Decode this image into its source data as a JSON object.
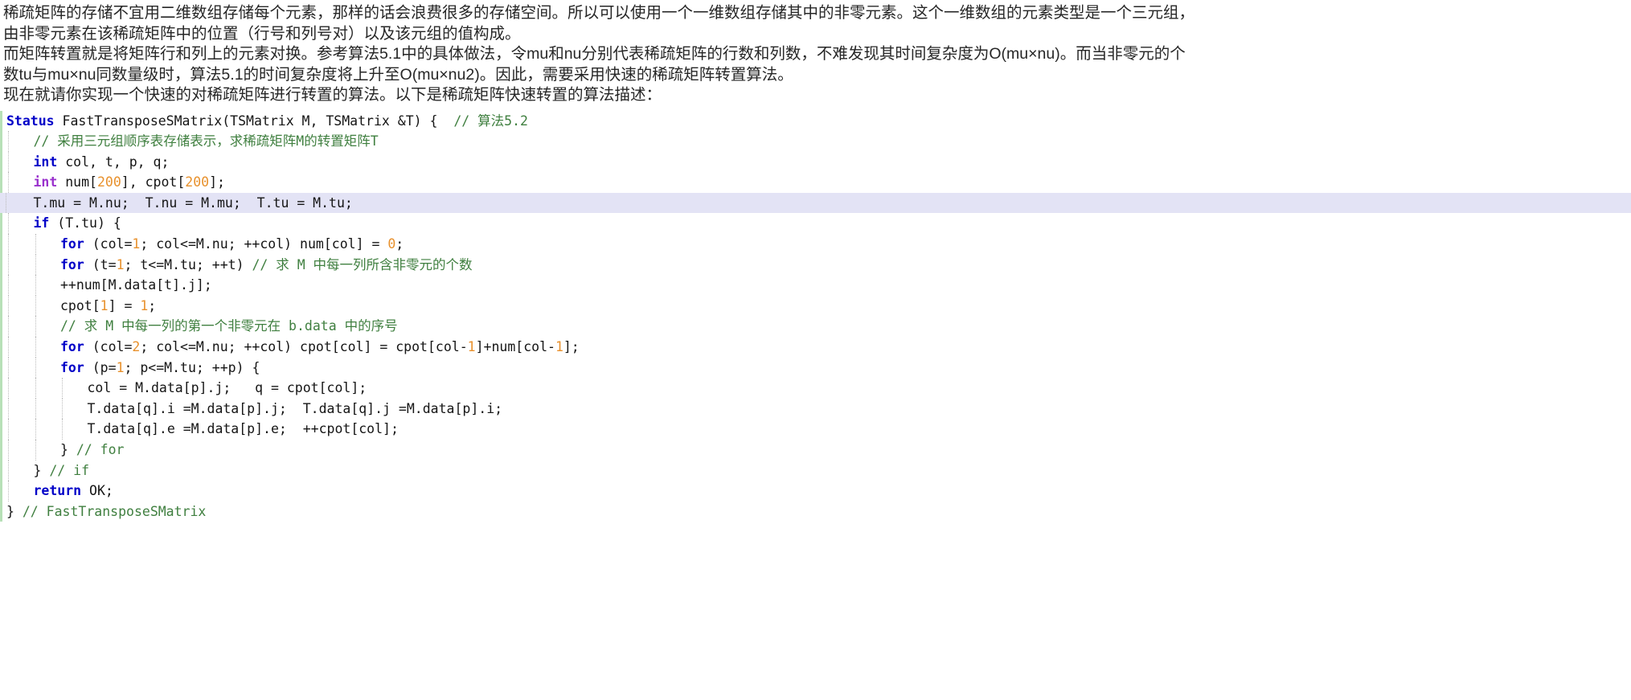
{
  "document": {
    "language": "zh-CN",
    "prose": [
      "稀疏矩阵的存储不宜用二维数组存储每个元素，那样的话会浪费很多的存储空间。所以可以使用一个一维数组存储其中的非零元素。这个一维数组的元素类型是一个三元组，",
      "由非零元素在该稀疏矩阵中的位置（行号和列号对）以及该元组的值构成。",
      "而矩阵转置就是将矩阵行和列上的元素对换。参考算法5.1中的具体做法，令mu和nu分别代表稀疏矩阵的行数和列数，不难发现其时间复杂度为O(mu×nu)。而当非零元的个",
      "数tu与mu×nu同数量级时，算法5.1的时间复杂度将上升至O(mu×nu2)。因此，需要采用快速的稀疏矩阵转置算法。",
      "现在就请你实现一个快速的对稀疏矩阵进行转置的算法。以下是稀疏矩阵快速转置的算法描述："
    ]
  },
  "code": {
    "language": "c",
    "highlighted_line_index": 4,
    "colors": {
      "keyword": "#0000c8",
      "type_keyword": "#9a32cd",
      "comment": "#3f7f3f",
      "number": "#e8912d",
      "plain": "#151515",
      "highlight_background": "#e3e3f5",
      "left_border": "#b7e0b7",
      "indent_guide": "#bcbcbc"
    },
    "lines": [
      {
        "indent": 0,
        "tokens": [
          {
            "t": "kw",
            "v": "Status"
          },
          {
            "t": "pln",
            "v": " FastTransposeSMatrix(TSMatrix M, TSMatrix &T) {  "
          },
          {
            "t": "cmt",
            "v": "// 算法5.2"
          }
        ]
      },
      {
        "indent": 1,
        "tokens": [
          {
            "t": "cmt",
            "v": "// 采用三元组顺序表存储表示，求稀疏矩阵M的转置矩阵T"
          }
        ]
      },
      {
        "indent": 1,
        "tokens": [
          {
            "t": "kw",
            "v": "int"
          },
          {
            "t": "pln",
            "v": " col, t, p, q;"
          }
        ]
      },
      {
        "indent": 1,
        "tokens": [
          {
            "t": "kw2",
            "v": "int"
          },
          {
            "t": "pln",
            "v": " num["
          },
          {
            "t": "num",
            "v": "200"
          },
          {
            "t": "pln",
            "v": "], cpot["
          },
          {
            "t": "num",
            "v": "200"
          },
          {
            "t": "pln",
            "v": "];"
          }
        ]
      },
      {
        "indent": 1,
        "tokens": [
          {
            "t": "pln",
            "v": "T.mu = M.nu;  T.nu = M.mu;  T.tu = M.tu;"
          }
        ]
      },
      {
        "indent": 1,
        "tokens": [
          {
            "t": "kw",
            "v": "if"
          },
          {
            "t": "pln",
            "v": " (T.tu) {"
          }
        ]
      },
      {
        "indent": 2,
        "tokens": [
          {
            "t": "kw",
            "v": "for"
          },
          {
            "t": "pln",
            "v": " (col="
          },
          {
            "t": "num",
            "v": "1"
          },
          {
            "t": "pln",
            "v": "; col<=M.nu; ++col) num[col] = "
          },
          {
            "t": "num",
            "v": "0"
          },
          {
            "t": "pln",
            "v": ";"
          }
        ]
      },
      {
        "indent": 2,
        "tokens": [
          {
            "t": "kw",
            "v": "for"
          },
          {
            "t": "pln",
            "v": " (t="
          },
          {
            "t": "num",
            "v": "1"
          },
          {
            "t": "pln",
            "v": "; t<=M.tu; ++t) "
          },
          {
            "t": "cmt",
            "v": "// 求 M 中每一列所含非零元的个数"
          }
        ]
      },
      {
        "indent": 2,
        "tokens": [
          {
            "t": "pln",
            "v": "++num[M.data[t].j];"
          }
        ]
      },
      {
        "indent": 2,
        "tokens": [
          {
            "t": "pln",
            "v": "cpot["
          },
          {
            "t": "num",
            "v": "1"
          },
          {
            "t": "pln",
            "v": "] = "
          },
          {
            "t": "num",
            "v": "1"
          },
          {
            "t": "pln",
            "v": ";"
          }
        ]
      },
      {
        "indent": 2,
        "tokens": [
          {
            "t": "cmt",
            "v": "// 求 M 中每一列的第一个非零元在 b.data 中的序号"
          }
        ]
      },
      {
        "indent": 2,
        "tokens": [
          {
            "t": "kw",
            "v": "for"
          },
          {
            "t": "pln",
            "v": " (col="
          },
          {
            "t": "num",
            "v": "2"
          },
          {
            "t": "pln",
            "v": "; col<=M.nu; ++col) cpot[col] = cpot[col-"
          },
          {
            "t": "num",
            "v": "1"
          },
          {
            "t": "pln",
            "v": "]+num[col-"
          },
          {
            "t": "num",
            "v": "1"
          },
          {
            "t": "pln",
            "v": "];"
          }
        ]
      },
      {
        "indent": 2,
        "tokens": [
          {
            "t": "kw",
            "v": "for"
          },
          {
            "t": "pln",
            "v": " (p="
          },
          {
            "t": "num",
            "v": "1"
          },
          {
            "t": "pln",
            "v": "; p<=M.tu; ++p) {"
          }
        ]
      },
      {
        "indent": 3,
        "tokens": [
          {
            "t": "pln",
            "v": "col = M.data[p].j;   q = cpot[col];"
          }
        ]
      },
      {
        "indent": 3,
        "tokens": [
          {
            "t": "pln",
            "v": "T.data[q].i =M.data[p].j;  T.data[q].j =M.data[p].i;"
          }
        ]
      },
      {
        "indent": 3,
        "tokens": [
          {
            "t": "pln",
            "v": "T.data[q].e =M.data[p].e;  ++cpot[col];"
          }
        ]
      },
      {
        "indent": 2,
        "tokens": [
          {
            "t": "pln",
            "v": "} "
          },
          {
            "t": "cmt",
            "v": "// for"
          }
        ]
      },
      {
        "indent": 1,
        "tokens": [
          {
            "t": "pln",
            "v": "} "
          },
          {
            "t": "cmt",
            "v": "// if"
          }
        ]
      },
      {
        "indent": 1,
        "tokens": [
          {
            "t": "kw",
            "v": "return"
          },
          {
            "t": "pln",
            "v": " OK;"
          }
        ]
      },
      {
        "indent": 0,
        "tokens": [
          {
            "t": "pln",
            "v": "} "
          },
          {
            "t": "cmt",
            "v": "// FastTransposeSMatrix"
          }
        ]
      }
    ]
  }
}
